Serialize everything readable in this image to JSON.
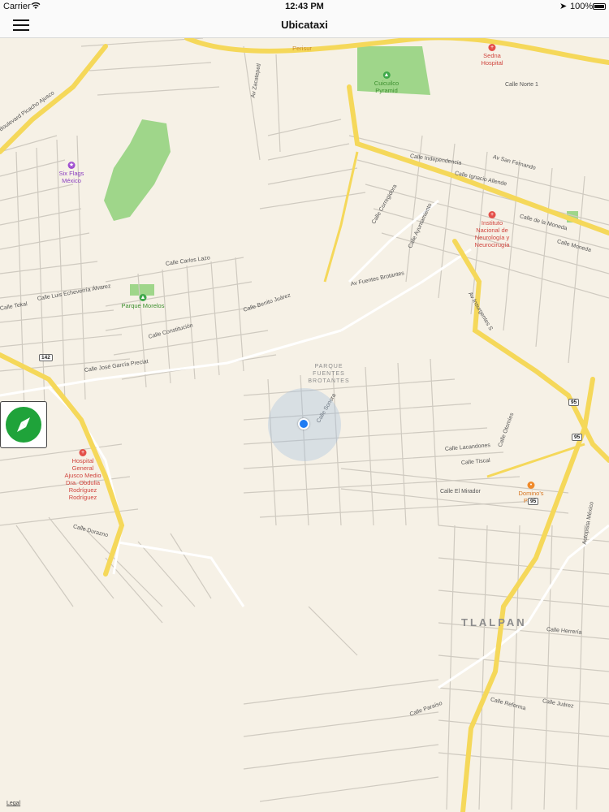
{
  "status_bar": {
    "carrier": "Carrier",
    "time": "12:43 PM",
    "battery": "100%"
  },
  "nav": {
    "title": "Ubicataxi"
  },
  "map": {
    "district": "TLALPAN",
    "neighborhood": "PARQUE\nFUENTES\nBROTANTES",
    "legal": "Legal",
    "route_shields": [
      "142",
      "95",
      "95",
      "95"
    ],
    "pois": [
      {
        "name": "Cuicuilco\nPyramid",
        "kind": "park"
      },
      {
        "name": "Six Flags\nMéxico",
        "kind": "attraction"
      },
      {
        "name": "Parque Morelos",
        "kind": "park"
      },
      {
        "name": "Sedna\nHospital",
        "kind": "hospital"
      },
      {
        "name": "Instituto\nNacional de\nNeurología y\nNeurocirugía",
        "kind": "hospital"
      },
      {
        "name": "Hospital\nGeneral\nAjusco Medio\nDra. Obdulia\nRodríguez\nRodríguez",
        "kind": "hospital"
      },
      {
        "name": "Domino's\nPizza",
        "kind": "food"
      },
      {
        "name": "Perisur",
        "kind": "shopping"
      }
    ],
    "streets": [
      "Boulevard Picacho Ajusco",
      "Av Zacatepetl",
      "Calle Norte 1",
      "Av San Fernando",
      "Calle Independencia",
      "Calle Ignacio Allende",
      "Calle de la Moneda",
      "Calle Corregidora",
      "Calle Ayuntamiento",
      "Av Insurgentes S",
      "Calle Carlos Lazo",
      "Calle Luis Echeverría Álvarez",
      "Calle Benito Juárez",
      "Calle Constitución",
      "Calle José García Preciat",
      "Calle Tekal",
      "Calle Sonora",
      "Av Fuentes Brotantes",
      "Calle Lacandones",
      "Calle Tiscal",
      "Calle El Mirador",
      "Calle Otomíes",
      "Calle Herrería",
      "Calle Juárez",
      "Calle Reforma",
      "Calle Durazno",
      "Calle Paraíso",
      "Autopista México",
      "Calle Moneda"
    ]
  },
  "colors": {
    "map_background": "#f6f1e6",
    "major_road": "#f5d85a",
    "park": "#9fd68a",
    "hospital": "#e4504a",
    "attraction": "#a04fd0",
    "user_location": "#1f7cf3",
    "compass_button": "#1fa33a"
  },
  "icons": {
    "menu": "hamburger-icon",
    "compass": "compass-icon",
    "location": "current-location-icon",
    "signal": "wifi-icon",
    "battery": "battery-icon"
  }
}
